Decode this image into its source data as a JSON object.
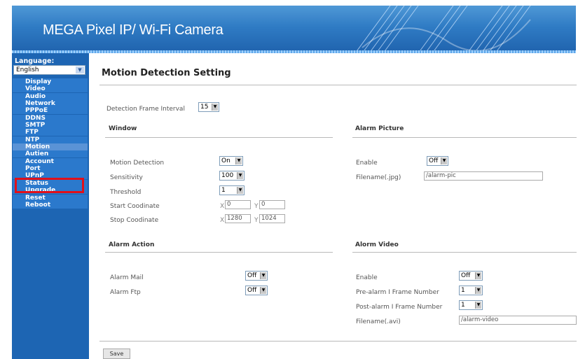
{
  "header": {
    "title": "MEGA Pixel IP/ Wi-Fi Camera"
  },
  "sidebar": {
    "language_label": "Language:",
    "language_value": "English",
    "items": [
      {
        "label": "Display"
      },
      {
        "label": "Video"
      },
      {
        "label": "Audio"
      },
      {
        "label": "Network"
      },
      {
        "label": "PPPoE"
      },
      {
        "label": "DDNS"
      },
      {
        "label": "SMTP"
      },
      {
        "label": "FTP"
      },
      {
        "label": "NTP"
      },
      {
        "label": "Motion",
        "active": true
      },
      {
        "label": "Autien"
      },
      {
        "label": "Account"
      },
      {
        "label": "Port"
      },
      {
        "label": "UPnP"
      },
      {
        "label": "Status"
      },
      {
        "label": "Upgrade"
      },
      {
        "label": "Reset"
      },
      {
        "label": "Reboot"
      }
    ]
  },
  "page": {
    "title": "Motion Detection Setting",
    "interval_label": "Detection Frame Interval",
    "interval_value": "15",
    "window": {
      "heading": "Window",
      "motion_label": "Motion Detection",
      "motion_value": "On",
      "sensitivity_label": "Sensitivity",
      "sensitivity_value": "100",
      "threshold_label": "Threshold",
      "threshold_value": "1",
      "start_label": "Start Coodinate",
      "start_x": "0",
      "start_y": "0",
      "stop_label": "Stop Coodinate",
      "stop_x": "1280",
      "stop_y": "1024",
      "x_label": "X",
      "y_label": "Y"
    },
    "alarm_picture": {
      "heading": "Alarm Picture",
      "enable_label": "Enable",
      "enable_value": "Off",
      "filename_label": "Filename(.jpg)",
      "filename_value": "/alarm-pic"
    },
    "alarm_action": {
      "heading": "Alarm Action",
      "mail_label": "Alarm Mail",
      "mail_value": "Off",
      "ftp_label": "Alarm Ftp",
      "ftp_value": "Off"
    },
    "alarm_video": {
      "heading": "Alorm Video",
      "enable_label": "Enable",
      "enable_value": "Off",
      "pre_label": "Pre-alarm I Frame Number",
      "pre_value": "1",
      "post_label": "Post-alarm I Frame Number",
      "post_value": "1",
      "filename_label": "Filename(.avi)",
      "filename_value": "/alarm-video"
    },
    "save_label": "Save"
  }
}
